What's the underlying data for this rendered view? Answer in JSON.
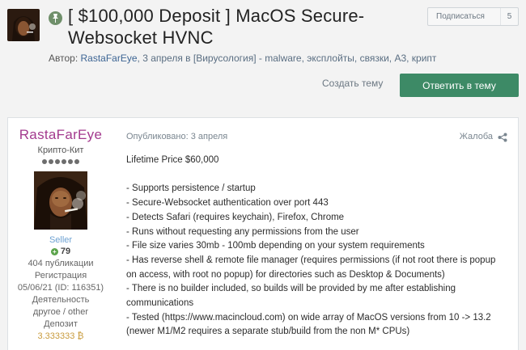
{
  "topic": {
    "title_line1": "[ $100,000 Deposit ] MacOS Secure-",
    "title_line2": "Websocket HVNC",
    "meta_prefix": "Автор: ",
    "author": "RastaFarEye",
    "meta_date": ", 3 апреля в ",
    "forum_link": "[Вирусология]",
    "meta_tags": " - malware, эксплойты, связки, А3, крипт"
  },
  "subscribe": {
    "label": "Подписаться",
    "count": "5"
  },
  "actions": {
    "create_topic": "Создать тему",
    "reply": "Ответить в тему"
  },
  "post": {
    "username": "RastaFarEye",
    "rank": "Крипто-Кит",
    "group": "Seller",
    "reputation": "79",
    "posts": "404 публикации",
    "reg_label": "Регистрация",
    "reg_value": "05/06/21 (ID: 116351)",
    "activity_label": "Деятельность",
    "activity_value": "другое / other",
    "deposit_label": "Депозит",
    "deposit_value": "3.333333 ₿",
    "posted": "Опубликовано: 3 апреля",
    "report": "Жалоба",
    "lines": [
      "Lifetime Price $60,000",
      "",
      "- Supports persistence / startup",
      "- Secure-Websocket authentication over port 443",
      "- Detects Safari (requires keychain), Firefox, Chrome",
      "- Runs without requesting any permissions from the user",
      "- File size varies 30mb - 100mb depending on your system requirements",
      "- Has reverse shell & remote file manager (requires permissions (if not root there is popup",
      "on access, with root no popup) for directories such as Desktop & Documents)",
      "- There is no builder included, so builds will be provided by me after establishing",
      "communications",
      "- Tested (https://www.macincloud.com) on wide array of MacOS versions from 10 -> 13.2",
      "(newer M1/M2 requires a separate stub/build from the non M* CPUs)"
    ]
  },
  "colors": {
    "reply_button": "#3d8a66",
    "username": "#a33a8e",
    "author_link": "#3d6594",
    "group": "#6da1d2",
    "deposit": "#c89b3c"
  }
}
